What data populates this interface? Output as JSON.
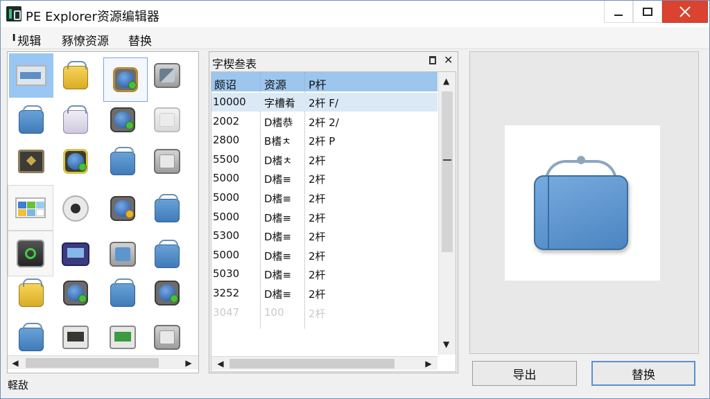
{
  "window": {
    "title": "PE Explorer资源编辑器",
    "accent": "#99c6f2",
    "close_color": "#d9432f"
  },
  "menu": {
    "items": [
      "╹规辑",
      "豩憭资源",
      "替换"
    ]
  },
  "icon_panel": {
    "icons": [
      "tile-window-icon",
      "yellow-bag-icon",
      "globe-frame-icon",
      "gray-box-icon",
      "blue-bag-icon",
      "white-bag-icon",
      "globe-frame-icon",
      "white-box-icon",
      "dark-frame-icon",
      "globe-gold-icon",
      "blue-bag-icon",
      "network-box-icon",
      "color-tiles-icon",
      "disk-icon",
      "globe-frame-icon",
      "blue-bag-icon",
      "cube-icon",
      "monitor-icon",
      "blue-box-icon",
      "blue-bag-icon",
      "yellow-bag-icon",
      "globe-frame-icon",
      "blue-bag-icon",
      "globe-frame-icon",
      "blue-bag-icon",
      "dark-card-icon",
      "green-card-icon",
      "network-box-icon"
    ]
  },
  "list_panel": {
    "title": "字楔叁表",
    "columns": [
      "颇诏",
      "资源",
      "P杆"
    ],
    "rows": [
      {
        "id": "10000",
        "type": "字槽肴",
        "desc": "2杆 F/"
      },
      {
        "id": "2002",
        "type": "D榰恭",
        "desc": "2杆 2/"
      },
      {
        "id": "2800",
        "type": "B榰ㅊ",
        "desc": "2杆 P"
      },
      {
        "id": "5500",
        "type": "D榰ㅊ",
        "desc": "2杆"
      },
      {
        "id": "5000",
        "type": "D榰≡",
        "desc": "2杆"
      },
      {
        "id": "5000",
        "type": "D榰≡",
        "desc": "2杆"
      },
      {
        "id": "5000",
        "type": "D榰≡",
        "desc": "2杆"
      },
      {
        "id": "5300",
        "type": "D榰≡",
        "desc": "2杆"
      },
      {
        "id": "5000",
        "type": "D榰≡",
        "desc": "2杆"
      },
      {
        "id": "5030",
        "type": "D榰≡",
        "desc": "2杆"
      },
      {
        "id": "3252",
        "type": "D榰≡",
        "desc": "2杆"
      },
      {
        "id": "3047",
        "type": "100",
        "desc": "2杆"
      }
    ]
  },
  "buttons": {
    "export": "导出",
    "replace": "替换"
  },
  "status": {
    "text": "軽敌"
  }
}
